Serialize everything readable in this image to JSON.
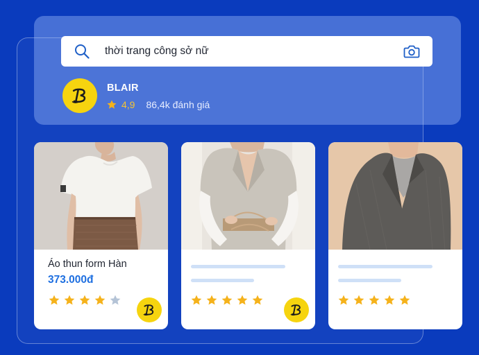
{
  "search": {
    "query": "thời trang công sở nữ",
    "icon": "search-icon",
    "camera_icon": "camera-icon"
  },
  "store": {
    "logo_icon": "blair-logo",
    "name": "BLAIR",
    "rating": "4,9",
    "reviews": "86,4k đánh giá"
  },
  "colors": {
    "background": "#0a3bbd",
    "star": "#f5b21b",
    "star_empty": "#b4c3d6",
    "price": "#1e6fe0",
    "logo": "#f6d40f",
    "placeholder": "#cfe0f7"
  },
  "products": [
    {
      "title": "Áo thun form Hàn",
      "price": "373.000đ",
      "stars_filled": 4,
      "stars_total": 5
    },
    {
      "title": "",
      "price": "",
      "stars_filled": 5,
      "stars_total": 5
    },
    {
      "title": "",
      "price": "",
      "stars_filled": 5,
      "stars_total": 5
    }
  ]
}
